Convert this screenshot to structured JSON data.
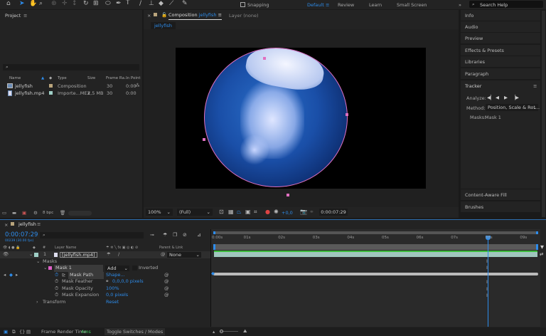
{
  "toolbar": {
    "snapping_label": "Snapping",
    "workspaces": [
      "Default",
      "Review",
      "Learn",
      "Small Screen"
    ],
    "active_workspace": "Default",
    "search_placeholder": "Search Help"
  },
  "project": {
    "title": "Project",
    "search_placeholder": "",
    "columns": [
      "Name",
      "Type",
      "Size",
      "Frame Ra...",
      "In Point"
    ],
    "items": [
      {
        "name": "jellyfish",
        "type": "Composition",
        "size": "",
        "fps": "30",
        "in": "0:00",
        "label_color": "#b9a47c"
      },
      {
        "name": "jellyfish.mp4",
        "type": "Importe...MEX",
        "size": "2,5 MB",
        "fps": "30",
        "in": "0:00",
        "label_color": "#9fcfc6"
      }
    ],
    "bpc": "8 bpc"
  },
  "composition": {
    "tab_prefix": "Composition",
    "tab_name": "jellyfish",
    "layer_tab": "Layer (none)",
    "subtab": "jellyfish",
    "zoom": "100%",
    "resolution": "(Full)",
    "exposure": "+0,0",
    "timecode": "0:00:07:29"
  },
  "right_panels": {
    "top": [
      "Info",
      "Audio",
      "Preview",
      "Effects & Presets",
      "Libraries",
      "Paragraph"
    ],
    "tracker": {
      "title": "Tracker",
      "analyze_label": "Analyze:",
      "method_label": "Method:",
      "method_value": "Position, Scale & Rot...",
      "masks_label": "Masks:",
      "masks_value": "Mask 1"
    },
    "bottom": [
      "Content-Aware Fill",
      "Brushes"
    ]
  },
  "timeline": {
    "tab": "jellyfish",
    "timecode": "0:00:07:29",
    "frames": "00239 (30.00 fps)",
    "columns": {
      "layer_name": "Layer Name",
      "parent": "Parent & Link",
      "num": "#"
    },
    "layer": {
      "num": "1",
      "name": "[jellyfish.mp4]",
      "parent": "None",
      "label_color": "#9fcfc6"
    },
    "masks_label": "Masks",
    "mask1": {
      "name": "Mask 1",
      "mode": "Add",
      "inverted": "Inverted",
      "color": "#e060c8"
    },
    "props": [
      {
        "name": "Mask Path",
        "value": "Shape..."
      },
      {
        "name": "Mask Feather",
        "value": "0,0,0,0 pixels"
      },
      {
        "name": "Mask Opacity",
        "value": "100%"
      },
      {
        "name": "Mask Expansion",
        "value": "0,0 pixels"
      }
    ],
    "transform": {
      "name": "Transform",
      "value": "Reset"
    },
    "ruler": [
      "0:00s",
      "01s",
      "02s",
      "03s",
      "04s",
      "05s",
      "06s",
      "07s",
      "08s",
      "09s"
    ],
    "current_time_s": 7.97,
    "footer": {
      "render_label": "Frame Render Time",
      "render_value": "4ms",
      "toggle": "Toggle Switches / Modes"
    }
  }
}
